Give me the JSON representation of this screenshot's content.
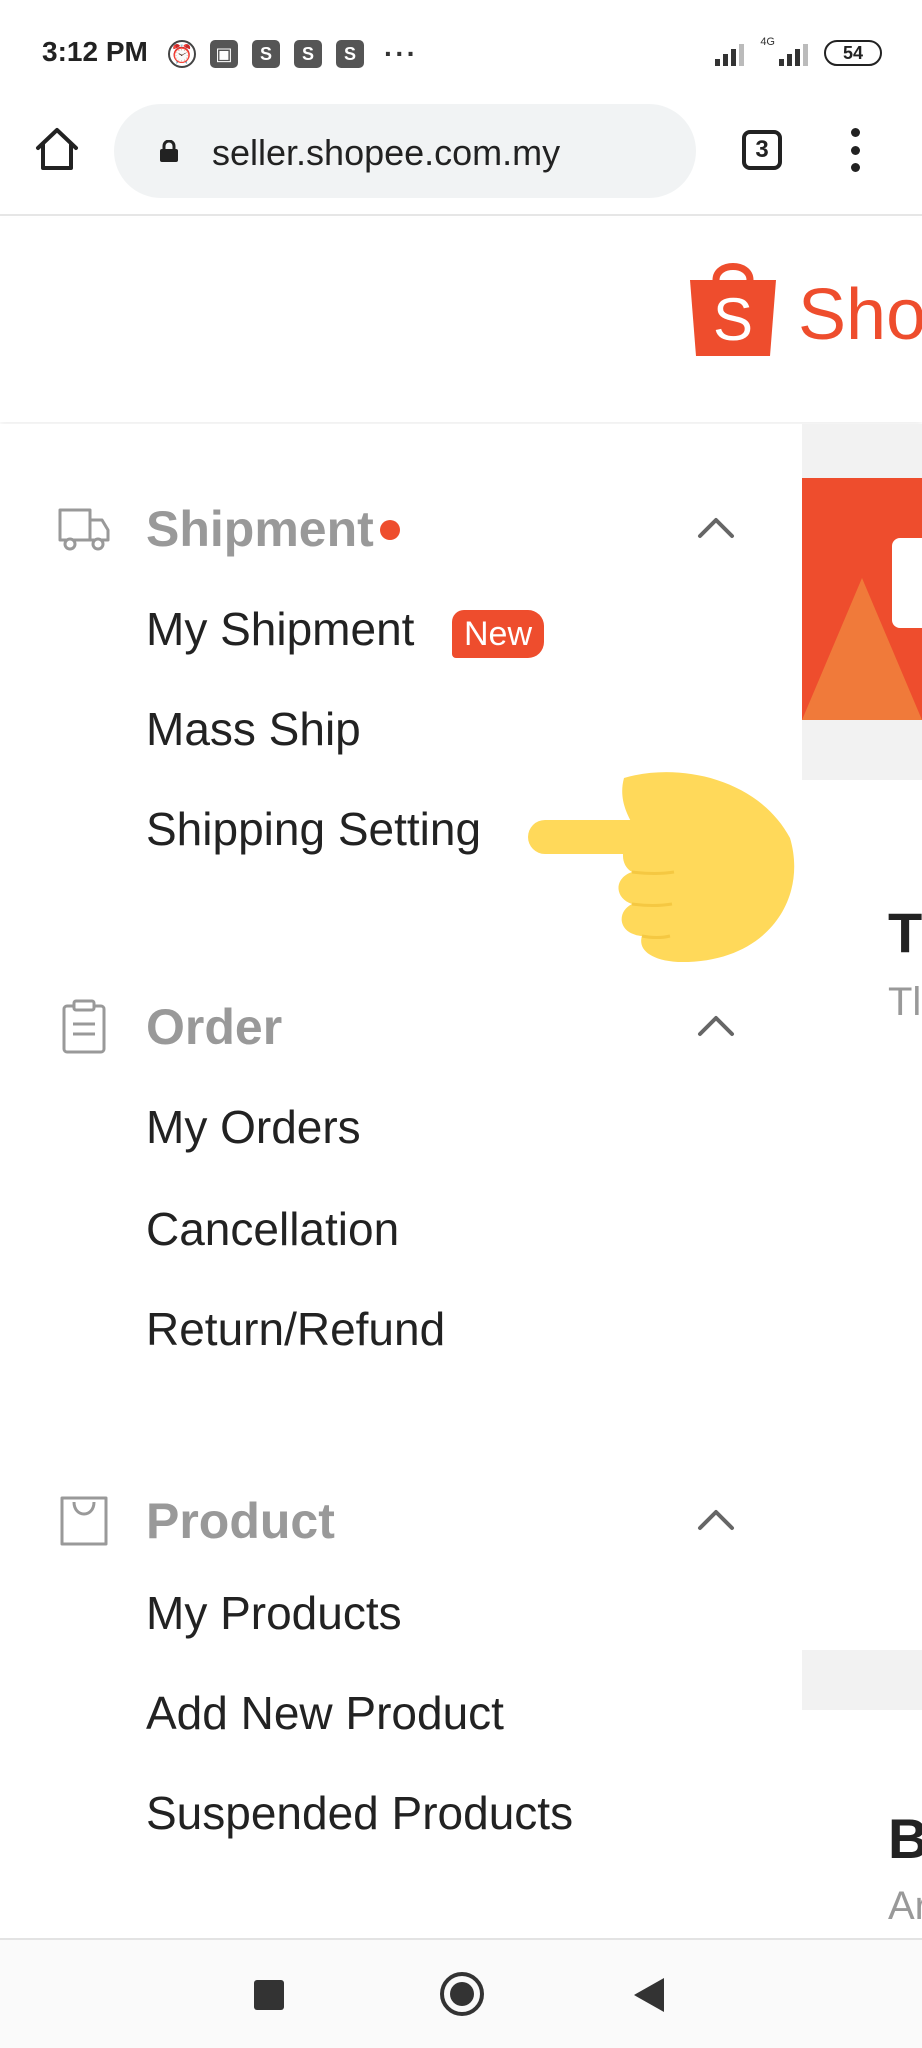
{
  "status_bar": {
    "time": "3:12 PM",
    "icons": [
      "alarm-icon",
      "picture-icon",
      "shopee-notification-icon",
      "shopee-notification-icon",
      "shopee-notification-icon"
    ],
    "more": "···",
    "network_label": "4G",
    "battery": "54"
  },
  "browser": {
    "url": "seller.shopee.com.my",
    "tab_count": "3"
  },
  "header": {
    "logo_letter": "S",
    "logo_text": "Sho"
  },
  "sidebar": {
    "groups": [
      {
        "title": "Shipment",
        "icon": "truck-icon",
        "has_dot": true,
        "items": [
          {
            "label": "My Shipment",
            "badge": "New"
          },
          {
            "label": "Mass Ship"
          },
          {
            "label": "Shipping Setting"
          }
        ]
      },
      {
        "title": "Order",
        "icon": "clipboard-icon",
        "items": [
          {
            "label": "My Orders"
          },
          {
            "label": "Cancellation"
          },
          {
            "label": "Return/Refund"
          }
        ]
      },
      {
        "title": "Product",
        "icon": "shopping-bag-icon",
        "items": [
          {
            "label": "My Products"
          },
          {
            "label": "Add New Product"
          },
          {
            "label": "Suspended Products"
          }
        ]
      }
    ]
  },
  "right_panel": {
    "card1_title": "T",
    "card1_sub": "Tl",
    "card2_title": "B",
    "card2_sub": "Ar"
  },
  "colors": {
    "brand": "#ee4d2d",
    "muted_heading": "#999999",
    "hand": "#ffd95a"
  }
}
